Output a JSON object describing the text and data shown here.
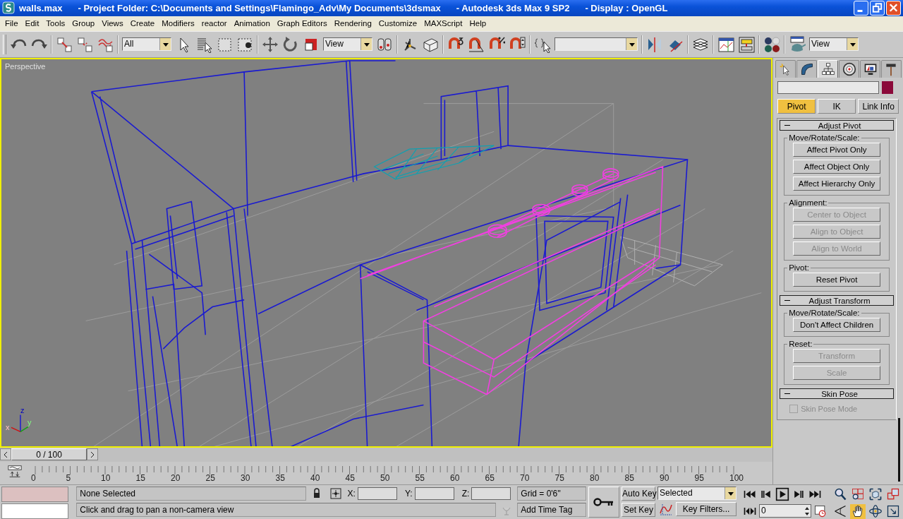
{
  "window": {
    "title_parts": [
      "walls.max",
      "- Project Folder: C:\\Documents and Settings\\Flamingo_Adv\\My Documents\\3dsmax",
      "- Autodesk 3ds Max 9 SP2",
      "- Display : OpenGL"
    ]
  },
  "menu": [
    "File",
    "Edit",
    "Tools",
    "Group",
    "Views",
    "Create",
    "Modifiers",
    "reactor",
    "Animation",
    "Graph Editors",
    "Rendering",
    "Customize",
    "MAXScript",
    "Help"
  ],
  "toolbar": {
    "selection_filter": "All",
    "reference_coordinate": "View",
    "render_view": "View"
  },
  "viewport": {
    "label": "Perspective",
    "axis_labels": [
      "x",
      "y",
      "z"
    ]
  },
  "command_panel": {
    "tabs": [
      {
        "selected": false
      },
      {
        "selected": false
      },
      {
        "selected": true
      },
      {
        "selected": false
      },
      {
        "selected": false
      },
      {
        "selected": false
      }
    ],
    "modes": [
      {
        "label": "Pivot",
        "selected": true
      },
      {
        "label": "IK",
        "selected": false
      },
      {
        "label": "Link Info",
        "selected": false
      }
    ],
    "rollouts": [
      {
        "title": "Adjust Pivot",
        "expanded": true,
        "groups": [
          {
            "label": "Move/Rotate/Scale:",
            "buttons": [
              {
                "label": "Affect Pivot Only",
                "disabled": false
              },
              {
                "label": "Affect Object Only",
                "disabled": false
              },
              {
                "label": "Affect Hierarchy Only",
                "disabled": false
              }
            ]
          },
          {
            "label": "Alignment:",
            "buttons": [
              {
                "label": "Center to Object",
                "disabled": true
              },
              {
                "label": "Align to Object",
                "disabled": true
              },
              {
                "label": "Align to World",
                "disabled": true
              }
            ]
          },
          {
            "label": "Pivot:",
            "buttons": [
              {
                "label": "Reset Pivot",
                "disabled": false
              }
            ]
          }
        ]
      },
      {
        "title": "Adjust Transform",
        "expanded": true,
        "groups": [
          {
            "label": "Move/Rotate/Scale:",
            "buttons": [
              {
                "label": "Don't Affect Children",
                "disabled": false
              }
            ]
          },
          {
            "label": "Reset:",
            "buttons": [
              {
                "label": "Transform",
                "disabled": true
              },
              {
                "label": "Scale",
                "disabled": true
              }
            ]
          }
        ]
      },
      {
        "title": "Skin Pose",
        "expanded": true,
        "checkboxes": [
          {
            "label": "Skin Pose Mode",
            "checked": false,
            "disabled": true
          }
        ]
      }
    ]
  },
  "timeline": {
    "slider_label": "0 / 100",
    "ticks": [
      "0",
      "5",
      "10",
      "15",
      "20",
      "25",
      "30",
      "35",
      "40",
      "45",
      "50",
      "55",
      "60",
      "65",
      "70",
      "75",
      "80",
      "85",
      "90",
      "95",
      "100"
    ]
  },
  "status": {
    "selection": "None Selected",
    "prompt": "Click and drag to pan a non-camera view",
    "x_label": "X:",
    "y_label": "Y:",
    "z_label": "Z:",
    "grid": "Grid = 0'6''",
    "time_tag": "Add Time Tag",
    "auto_key": "Auto Key",
    "set_key": "Set Key",
    "key_mode": "Selected",
    "key_filters": "Key Filters...",
    "frame": "0",
    "nav_tools": [
      {
        "selected": false
      },
      {
        "selected": false
      },
      {
        "selected": false
      },
      {
        "selected": false
      },
      {
        "selected": false
      },
      {
        "selected": true
      },
      {
        "selected": false
      },
      {
        "selected": false
      }
    ]
  }
}
